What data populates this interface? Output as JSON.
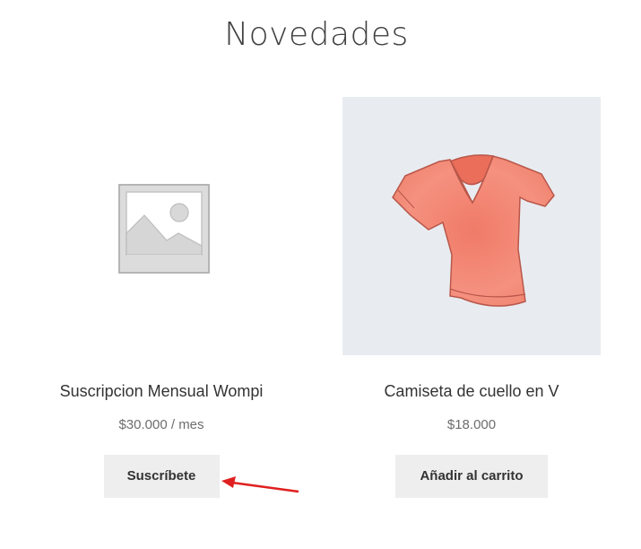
{
  "section": {
    "title": "Novedades"
  },
  "products": [
    {
      "name": "Suscripcion Mensual Wompi",
      "price": "$30.000",
      "price_suffix": " / mes",
      "button": "Suscríbete",
      "image": "placeholder-image-icon"
    },
    {
      "name": "Camiseta de cuello en V",
      "price": "$18.000",
      "button": "Añadir al carrito",
      "image": "vneck-tshirt-image"
    }
  ],
  "annotation": {
    "arrow_color": "#e02020"
  },
  "colors": {
    "button_bg": "#eeeeee",
    "thumb_bg": "#e8ecf1",
    "shirt": "#f08c7c"
  }
}
